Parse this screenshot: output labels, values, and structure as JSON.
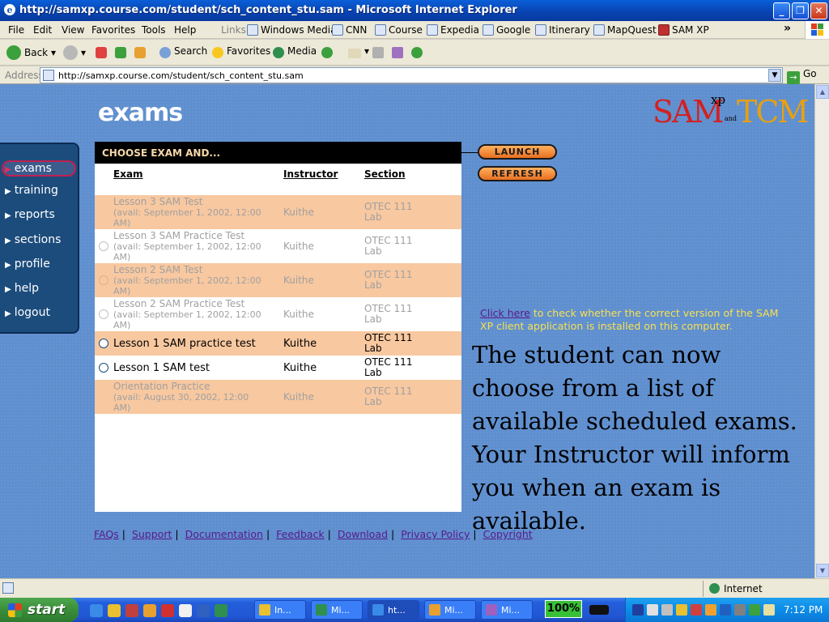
{
  "window": {
    "title": "http://samxp.course.com/student/sch_content_stu.sam - Microsoft Internet Explorer",
    "min": "_",
    "max": "❐",
    "close": "✕"
  },
  "menu": [
    "File",
    "Edit",
    "View",
    "Favorites",
    "Tools",
    "Help"
  ],
  "links": {
    "label": "Links",
    "items": [
      "Windows Media",
      "CNN",
      "Course",
      "Expedia",
      "Google",
      "Itinerary",
      "MapQuest",
      "SAM XP"
    ],
    "more": "»"
  },
  "toolbar": {
    "back": "Back",
    "search": "Search",
    "favorites": "Favorites",
    "media": "Media"
  },
  "address": {
    "label": "Address",
    "url": "http://samxp.course.com/student/sch_content_stu.sam",
    "go": "Go"
  },
  "page": {
    "heading": "exams",
    "logo": {
      "sam": "SAM",
      "xp": "xp",
      "and": "and",
      "tcm": "TCM"
    },
    "nav": [
      "exams",
      "training",
      "reports",
      "sections",
      "profile",
      "help",
      "logout"
    ],
    "panel": {
      "header": "CHOOSE EXAM AND...",
      "columns": {
        "exam": "Exam",
        "instructor": "Instructor",
        "section": "Section"
      },
      "rows": [
        {
          "exam": "Lesson 3 SAM Test",
          "avail": "(avail: September 1, 2002, 12:00 AM)",
          "instructor": "Kuithe",
          "section": "OTEC 111 Lab"
        },
        {
          "exam": "Lesson 3 SAM Practice Test",
          "avail": "(avail: September 1, 2002, 12:00 AM)",
          "instructor": "Kuithe",
          "section": "OTEC 111 Lab"
        },
        {
          "exam": "Lesson 2 SAM Test",
          "avail": "(avail: September 1, 2002, 12:00 AM)",
          "instructor": "Kuithe",
          "section": "OTEC 111 Lab"
        },
        {
          "exam": "Lesson 2 SAM Practice Test",
          "avail": "(avail: September 1, 2002, 12:00 AM)",
          "instructor": "Kuithe",
          "section": "OTEC 111 Lab"
        },
        {
          "exam": "Lesson 1 SAM practice test",
          "avail": "",
          "instructor": "Kuithe",
          "section": "OTEC 111 Lab"
        },
        {
          "exam": "Lesson 1 SAM test",
          "avail": "",
          "instructor": "Kuithe",
          "section": "OTEC 111 Lab"
        },
        {
          "exam": "Orientation Practice",
          "avail": "(avail: August 30, 2002, 12:00 AM)",
          "instructor": "Kuithe",
          "section": "OTEC 111 Lab"
        }
      ]
    },
    "buttons": {
      "launch": "LAUNCH",
      "refresh": "REFRESH"
    },
    "client_check": {
      "link": "Click here",
      "text": " to check whether the correct version of the SAM XP client application is installed on this computer."
    },
    "instruction": "The student can now choose from a list of available scheduled exams. Your Instructor will inform you when an exam is available.",
    "footer": [
      "FAQs",
      "Support",
      "Documentation",
      "Feedback",
      "Download",
      "Privacy Policy",
      "Copyright"
    ]
  },
  "status": {
    "zone": "Internet"
  },
  "taskbar": {
    "start": "start",
    "tasks": [
      "In...",
      "Mi...",
      "ht...",
      "Mi...",
      "Mi..."
    ],
    "zoom": "100%",
    "clock": "7:12 PM"
  }
}
